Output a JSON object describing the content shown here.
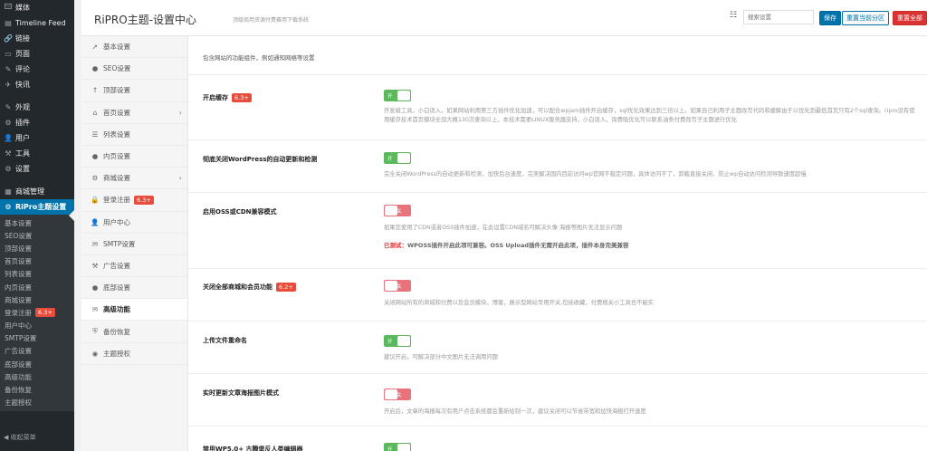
{
  "wp_menu": {
    "top_items": [
      {
        "icon": "media-icon",
        "glyph": "🖾",
        "label": "媒体"
      },
      {
        "icon": "timeline-icon",
        "glyph": "▤",
        "label": "Timeline Feed"
      },
      {
        "icon": "link-icon",
        "glyph": "🔗",
        "label": "链接"
      },
      {
        "icon": "page-icon",
        "glyph": "▭",
        "label": "页面"
      },
      {
        "icon": "comment-icon",
        "glyph": "✎",
        "label": "评论"
      },
      {
        "icon": "flash-icon",
        "glyph": "✈",
        "label": "快讯"
      }
    ],
    "mid_items": [
      {
        "icon": "appearance-icon",
        "glyph": "✎",
        "label": "外观"
      },
      {
        "icon": "plugin-icon",
        "glyph": "⚙",
        "label": "插件"
      },
      {
        "icon": "user-icon",
        "glyph": "👤",
        "label": "用户"
      },
      {
        "icon": "tools-icon",
        "glyph": "⚒",
        "label": "工具"
      },
      {
        "icon": "settings-icon",
        "glyph": "⚙",
        "label": "设置"
      }
    ],
    "shop_label": "商城管理",
    "active_label": "RiPro主题设置",
    "sub_items": [
      {
        "label": "基本设置"
      },
      {
        "label": "SEO设置"
      },
      {
        "label": "顶部设置"
      },
      {
        "label": "首页设置"
      },
      {
        "label": "列表设置"
      },
      {
        "label": "内页设置"
      },
      {
        "label": "商城设置"
      },
      {
        "label": "登录注册",
        "badge": "6.3+"
      },
      {
        "label": "用户中心"
      },
      {
        "label": "SMTP设置"
      },
      {
        "label": "广告设置"
      },
      {
        "label": "底部设置"
      },
      {
        "label": "高级功能"
      },
      {
        "label": "备份恢复"
      },
      {
        "label": "主题授权"
      }
    ],
    "collapse_label": "收起菜单"
  },
  "header": {
    "title": "RiPRO主题-设置中心",
    "subtitle": "顶级商用资源付费赛用下载系统",
    "search_placeholder": "搜索设置",
    "save_label": "保存",
    "reset_section_label": "重置当前分区",
    "reset_all_label": "重置全部"
  },
  "options_nav": [
    {
      "icon": "rocket-icon",
      "glyph": "➚",
      "label": "基本设置"
    },
    {
      "icon": "circle-icon",
      "glyph": "●",
      "label": "SEO设置"
    },
    {
      "icon": "pin-icon",
      "glyph": "↑",
      "label": "顶部设置"
    },
    {
      "icon": "home-icon",
      "glyph": "⌂",
      "label": "首页设置",
      "chevron": true
    },
    {
      "icon": "list-icon",
      "glyph": "☰",
      "label": "列表设置"
    },
    {
      "icon": "circle-icon",
      "glyph": "●",
      "label": "内页设置"
    },
    {
      "icon": "shop-icon",
      "glyph": "⚙",
      "label": "商城设置",
      "chevron": true
    },
    {
      "icon": "lock-icon",
      "glyph": "🔒",
      "label": "登录注册",
      "badge": "6.3+"
    },
    {
      "icon": "user-icon",
      "glyph": "👤",
      "label": "用户中心"
    },
    {
      "icon": "mail-icon",
      "glyph": "✉",
      "label": "SMTP设置"
    },
    {
      "icon": "hammer-icon",
      "glyph": "⚒",
      "label": "广告设置"
    },
    {
      "icon": "circle-icon",
      "glyph": "●",
      "label": "底部设置"
    },
    {
      "icon": "envelope-icon",
      "glyph": "✉",
      "label": "高级功能",
      "active": true
    },
    {
      "icon": "shield-icon",
      "glyph": "⛨",
      "label": "备份恢复"
    },
    {
      "icon": "eye-icon",
      "glyph": "◉",
      "label": "主题授权"
    }
  ],
  "main": {
    "intro": "包含网站的功能组件，例如通知网络等设置",
    "options": [
      {
        "label": "开启缓存",
        "badge": "6.3+",
        "state": "on",
        "toggle_text": "开",
        "desc": "开发级工具，小白误入。如果网站利用第三方插件优化加速，可以配合wpjam插件开启缓存，sql优化效果达到三倍以上。如果自己利用子主题改写代码和缓解由于以优化到最低首页只有2个sql查询。ripro没有使用缓存技术首页模块全部大概130次查询以上，本技术需要LINUX服务器支持，小白误入，询费吸优化可以联系油条付费改写子主题进行优化"
      },
      {
        "label": "彻底关闭WordPress的自动更新和检测",
        "state": "on",
        "toggle_text": "开",
        "desc": "完全关闭WordPress的自动更新和检测，加快后台速度，完美解决国内目前访问wp官网不稳定问题，具体访问不了，卸载直接关闭，防止wp自动访问检测导致速度超慢"
      },
      {
        "label": "启用OSS或CDN兼容模式",
        "state": "off",
        "toggle_text": "关",
        "desc": "如果您使用了CDN或者OSS插件加速，在此设置CDN域名可解决头像 海报等图片无法显示问题",
        "warn_prefix": "已测试：",
        "warn": "WPOSS插件开启此项可兼容。OSS Upload插件无需开启此项，插件本身完美兼容"
      },
      {
        "label": "关闭全部商城和会员功能",
        "badge": "6.2+",
        "state": "off",
        "toggle_text": "关",
        "desc": "关闭网站所有的商城和付费以及会员模块，博客，展示型网站专用开关,包括收藏，付费相关小工具也不能实"
      },
      {
        "label": "上传文件重命名",
        "state": "on",
        "toggle_text": "开",
        "desc": "建议开启，可解决部分中文图片无法调用问题"
      },
      {
        "label": "实时更新文章海报图片模式",
        "state": "off",
        "toggle_text": "关",
        "desc": "开启后，文章的海报每次有用户点击系统都会重新绘制一次，建议关闭可以节省带宽和加快海报打开速度"
      },
      {
        "label": "禁用WP5.0+ 古腾堡反人类编辑器",
        "state": "on",
        "toggle_text": "开",
        "desc": ""
      }
    ]
  }
}
